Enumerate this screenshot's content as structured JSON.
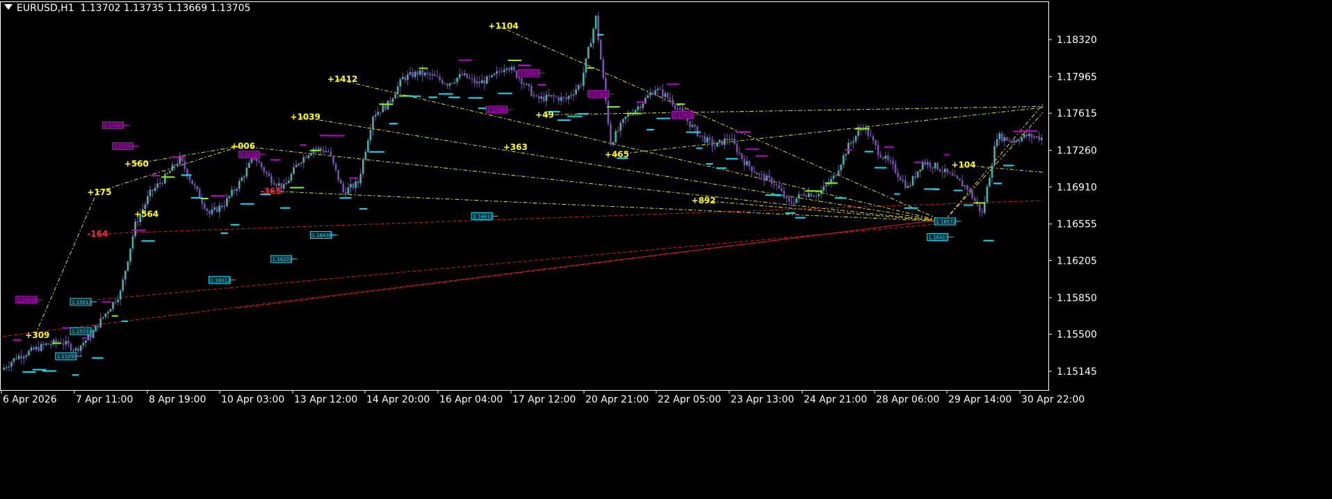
{
  "header": {
    "symbol": "EURUSD,H1",
    "ohlc": "1.13702 1.13735 1.13669 1.13705"
  },
  "colors": {
    "background": "#000000",
    "frame": "#ffffff",
    "axis_text": "#ffffff",
    "candles": "#7a50b8",
    "cyan_levels": "#00e5ff",
    "magenta_levels": "#c000d0",
    "green_levels": "#7fff00",
    "yellow_trend": "#e6e600",
    "red_trend": "#e01818",
    "label_yellow": "#ffff00",
    "label_red": "#ff2a2a"
  },
  "chart_data": {
    "type": "line",
    "chart_style": "candlestick with trendlines and level markers",
    "y_ticks": [
      "1.18320",
      "1.17965",
      "1.17615",
      "1.17260",
      "1.16910",
      "1.16555",
      "1.16205",
      "1.15850",
      "1.15500",
      "1.15145"
    ],
    "y_tick_values": [
      1.1832,
      1.17965,
      1.17615,
      1.1726,
      1.1691,
      1.16555,
      1.16205,
      1.1585,
      1.155,
      1.15145
    ],
    "ylim": [
      1.15,
      1.1883
    ],
    "x_ticks": [
      "6 Apr 2026",
      "7 Apr 11:00",
      "8 Apr 19:00",
      "10 Apr 03:00",
      "13 Apr 12:00",
      "14 Apr 20:00",
      "16 Apr 04:00",
      "17 Apr 12:00",
      "20 Apr 21:00",
      "22 Apr 05:00",
      "23 Apr 13:00",
      "24 Apr 21:00",
      "28 Apr 06:00",
      "29 Apr 14:00",
      "30 Apr 22:00"
    ],
    "price_path_bar_index": [
      0,
      6,
      12,
      18,
      24,
      30,
      36,
      42,
      48,
      54,
      60,
      66,
      72,
      78,
      84,
      90,
      96,
      102,
      108,
      114,
      120,
      126,
      132,
      138,
      144,
      150,
      156,
      162,
      168,
      174,
      180,
      186,
      192,
      198,
      204,
      210,
      216,
      222,
      228,
      234,
      240,
      246,
      252,
      258,
      264,
      270,
      276,
      282,
      288,
      294,
      300,
      306,
      312,
      318,
      324,
      330,
      336,
      342,
      348,
      354,
      360,
      366,
      372,
      378,
      384,
      390,
      396,
      402,
      408,
      414,
      420
    ],
    "price_path_close": [
      1.1516,
      1.1528,
      1.1534,
      1.154,
      1.1543,
      1.1535,
      1.1549,
      1.157,
      1.159,
      1.1655,
      1.1685,
      1.17,
      1.1718,
      1.169,
      1.1665,
      1.1675,
      1.1695,
      1.172,
      1.17,
      1.169,
      1.1715,
      1.1728,
      1.1725,
      1.1686,
      1.1695,
      1.176,
      1.177,
      1.1795,
      1.18,
      1.1797,
      1.179,
      1.1798,
      1.179,
      1.1795,
      1.1808,
      1.1793,
      1.1775,
      1.1777,
      1.1775,
      1.179,
      1.1853,
      1.1733,
      1.1757,
      1.177,
      1.1785,
      1.1775,
      1.1757,
      1.174,
      1.173,
      1.1738,
      1.1715,
      1.1702,
      1.1695,
      1.1675,
      1.1685,
      1.1684,
      1.17,
      1.173,
      1.175,
      1.1725,
      1.171,
      1.169,
      1.1715,
      1.171,
      1.17,
      1.169,
      1.1665,
      1.174,
      1.1735,
      1.174,
      1.1738
    ],
    "bar_count": 420,
    "swing_labels": [
      {
        "text": "+309",
        "bar": 13,
        "price": 1.1549,
        "color": "yellow"
      },
      {
        "text": "+175",
        "bar": 38,
        "price": 1.1686,
        "color": "yellow"
      },
      {
        "text": "-164",
        "bar": 38,
        "price": 1.1646,
        "color": "red"
      },
      {
        "text": "+560",
        "bar": 53,
        "price": 1.1713,
        "color": "yellow"
      },
      {
        "text": "+564",
        "bar": 57,
        "price": 1.1665,
        "color": "yellow"
      },
      {
        "text": "+006",
        "bar": 96,
        "price": 1.173,
        "color": "yellow"
      },
      {
        "text": "-365",
        "bar": 108,
        "price": 1.1687,
        "color": "red"
      },
      {
        "text": "+1039",
        "bar": 120,
        "price": 1.1758,
        "color": "yellow"
      },
      {
        "text": "+1412",
        "bar": 135,
        "price": 1.1794,
        "color": "yellow"
      },
      {
        "text": "+1104",
        "bar": 200,
        "price": 1.1845,
        "color": "yellow"
      },
      {
        "text": "+363",
        "bar": 206,
        "price": 1.1729,
        "color": "yellow"
      },
      {
        "text": "+49",
        "bar": 219,
        "price": 1.176,
        "color": "yellow"
      },
      {
        "text": "+465",
        "bar": 247,
        "price": 1.1722,
        "color": "yellow"
      },
      {
        "text": "+892",
        "bar": 282,
        "price": 1.1678,
        "color": "yellow"
      },
      {
        "text": "+104",
        "bar": 387,
        "price": 1.1712,
        "color": "yellow"
      }
    ],
    "price_boxes": [
      {
        "text": "1.15802",
        "bar": 12,
        "price": 1.1583,
        "color": "magenta"
      },
      {
        "text": "1.15813",
        "bar": 34,
        "price": 1.1581,
        "color": "cyan"
      },
      {
        "text": "1.15532",
        "bar": 34,
        "price": 1.1553,
        "color": "cyan"
      },
      {
        "text": "1.15295",
        "bar": 28,
        "price": 1.1529,
        "color": "cyan"
      },
      {
        "text": "1.17502",
        "bar": 47,
        "price": 1.175,
        "color": "magenta"
      },
      {
        "text": "1.17299",
        "bar": 51,
        "price": 1.173,
        "color": "magenta"
      },
      {
        "text": "1.17222",
        "bar": 102,
        "price": 1.1722,
        "color": "magenta"
      },
      {
        "text": "1.16012",
        "bar": 90,
        "price": 1.1602,
        "color": "cyan"
      },
      {
        "text": "1.16229",
        "bar": 115,
        "price": 1.1622,
        "color": "cyan"
      },
      {
        "text": "1.16438",
        "bar": 131,
        "price": 1.1645,
        "color": "cyan"
      },
      {
        "text": "1.16632",
        "bar": 196,
        "price": 1.1663,
        "color": "cyan"
      },
      {
        "text": "1.18015",
        "bar": 215,
        "price": 1.18,
        "color": "magenta"
      },
      {
        "text": "1.17650",
        "bar": 202,
        "price": 1.1765,
        "color": "magenta"
      },
      {
        "text": "1.17812",
        "bar": 243,
        "price": 1.178,
        "color": "magenta"
      },
      {
        "text": "1.17603",
        "bar": 277,
        "price": 1.176,
        "color": "magenta"
      },
      {
        "text": "1.16419",
        "bar": 380,
        "price": 1.1643,
        "color": "cyan"
      },
      {
        "text": "1.16572",
        "bar": 383,
        "price": 1.1658,
        "color": "cyan"
      }
    ],
    "yellow_trendlines": [
      [
        [
          38,
          1.1686
        ],
        [
          96,
          1.173
        ]
      ],
      [
        [
          53,
          1.1713
        ],
        [
          96,
          1.173
        ]
      ],
      [
        [
          96,
          1.173
        ],
        [
          380,
          1.1658
        ]
      ],
      [
        [
          120,
          1.1758
        ],
        [
          380,
          1.1658
        ]
      ],
      [
        [
          135,
          1.1794
        ],
        [
          380,
          1.1658
        ]
      ],
      [
        [
          200,
          1.1845
        ],
        [
          380,
          1.1658
        ]
      ],
      [
        [
          108,
          1.1687
        ],
        [
          380,
          1.1658
        ]
      ],
      [
        [
          247,
          1.1722
        ],
        [
          420,
          1.1767
        ]
      ],
      [
        [
          219,
          1.176
        ],
        [
          420,
          1.1768
        ]
      ],
      [
        [
          380,
          1.1658
        ],
        [
          420,
          1.1762
        ]
      ],
      [
        [
          380,
          1.1658
        ],
        [
          420,
          1.177
        ]
      ],
      [
        [
          387,
          1.1712
        ],
        [
          420,
          1.1705
        ]
      ],
      [
        [
          282,
          1.1678
        ],
        [
          380,
          1.1658
        ]
      ],
      [
        [
          13,
          1.1549
        ],
        [
          38,
          1.1686
        ]
      ]
    ],
    "red_trendlines": [
      [
        [
          0,
          1.1548
        ],
        [
          380,
          1.166
        ]
      ],
      [
        [
          38,
          1.1646
        ],
        [
          420,
          1.1678
        ]
      ],
      [
        [
          38,
          1.1583
        ],
        [
          380,
          1.1656
        ]
      ],
      [
        [
          95,
          1.1575
        ],
        [
          380,
          1.166
        ]
      ]
    ],
    "grid": false
  }
}
